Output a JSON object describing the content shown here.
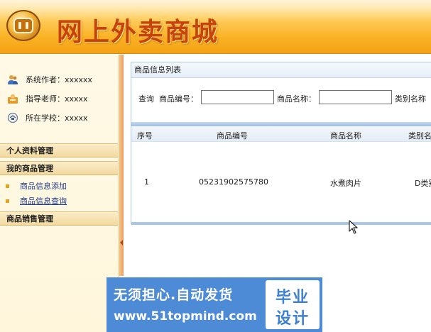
{
  "header": {
    "title": "网上外卖商城"
  },
  "sidebar": {
    "info": [
      {
        "label": "系统作者：xxxxxx",
        "icon": "users-icon"
      },
      {
        "label": "指导老师：xxxxx",
        "icon": "teacher-icon"
      },
      {
        "label": "所在学校：xxxxx",
        "icon": "school-icon"
      }
    ],
    "sections": [
      {
        "label": "个人资料管理"
      },
      {
        "label": "我的商品管理",
        "items": [
          "商品信息添加",
          "商品信息查询"
        ]
      },
      {
        "label": "商品销售管理"
      }
    ]
  },
  "main": {
    "panel_title": "商品信息列表",
    "search": {
      "query_label": "查询",
      "code_label": "商品编号：",
      "code_value": "",
      "name_label": "商品名称：",
      "name_value": "",
      "category_label": "类别名称"
    },
    "grid": {
      "headers": [
        "序号",
        "商品编号",
        "商品名称",
        "类别名"
      ],
      "rows": [
        [
          "1",
          "05231902575780",
          "水煮肉片",
          "D类别"
        ]
      ]
    }
  },
  "watermark": {
    "line1": "无须担心.自动发货",
    "line2": "www.51topmind.com",
    "badge_top": "毕业",
    "badge_bottom": "设计"
  },
  "colors": {
    "header_gradient_top": "#ffe9a8",
    "header_gradient_bottom": "#f3a214",
    "title_text": "#c6430c",
    "link": "#1d3c8f",
    "panel_border": "#a9c6e4",
    "watermark_bg": "#4d8bd6"
  }
}
